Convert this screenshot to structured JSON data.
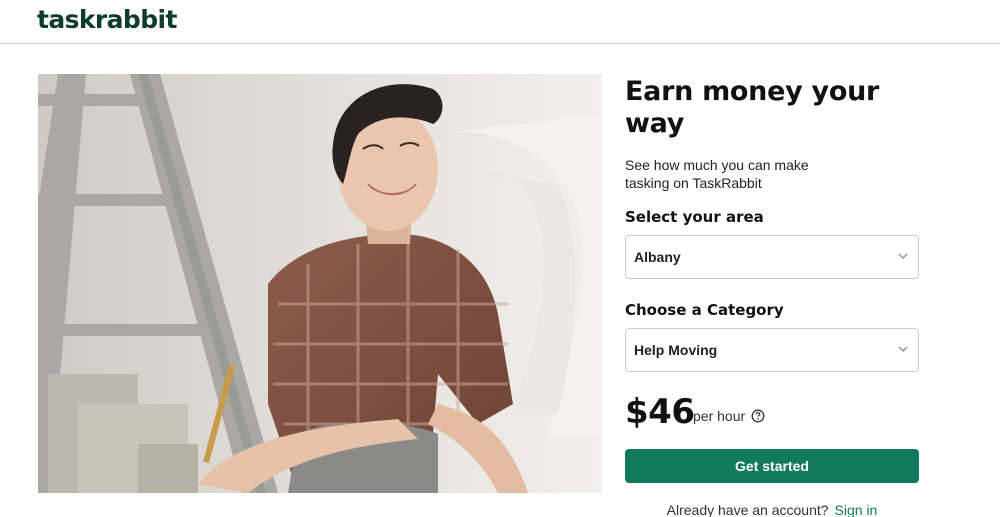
{
  "header": {
    "logo": "taskrabbit"
  },
  "hero": {
    "image": "smiling-tasker-photo"
  },
  "form": {
    "title": "Earn money your way",
    "subtitle": "See how much you can make tasking on TaskRabbit",
    "area_label": "Select your area",
    "area_value": "Albany",
    "category_label": "Choose a Category",
    "category_value": "Help Moving",
    "price": "$46",
    "price_unit": "per hour",
    "cta_label": "Get started",
    "account_prompt": "Already have an account?",
    "signin_label": "Sign in"
  },
  "colors": {
    "brand_green": "#127a5c",
    "logo_dark": "#0d3b2e"
  }
}
